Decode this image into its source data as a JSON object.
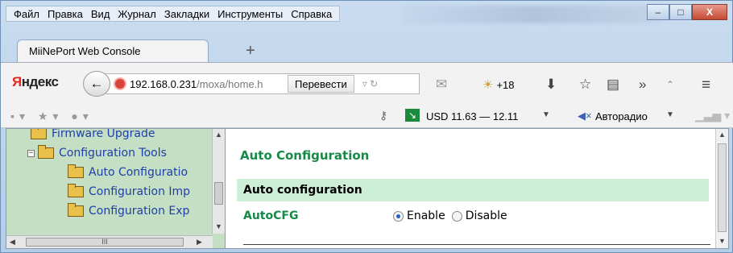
{
  "menu": [
    "Файл",
    "Правка",
    "Вид",
    "Журнал",
    "Закладки",
    "Инструменты",
    "Справка"
  ],
  "window_controls": {
    "minimize": "–",
    "maximize": "□",
    "close": "X"
  },
  "tab": {
    "title": "MiiNePort Web Console",
    "new_tab": "+"
  },
  "nav": {
    "brand_first": "Я",
    "brand_rest": "ндекс",
    "url_host": "192.168.0.231",
    "url_path": "/moxa/home.h",
    "translate": "Перевести",
    "weather": "+18"
  },
  "bookmarks": {
    "currency": "USD 11.63 — 12.11",
    "radio": "Авторадио"
  },
  "tree": [
    {
      "label": "Firmware Upgrade"
    },
    {
      "label": "Configuration Tools"
    },
    {
      "label": "Auto Configuratio"
    },
    {
      "label": "Configuration Imp"
    },
    {
      "label": "Configuration Exp"
    }
  ],
  "scroll_grip": "III",
  "page": {
    "title": "Auto Configuration",
    "section": "Auto configuration",
    "field_label": "AutoCFG",
    "options": [
      "Enable",
      "Disable"
    ],
    "selected": "Enable"
  }
}
